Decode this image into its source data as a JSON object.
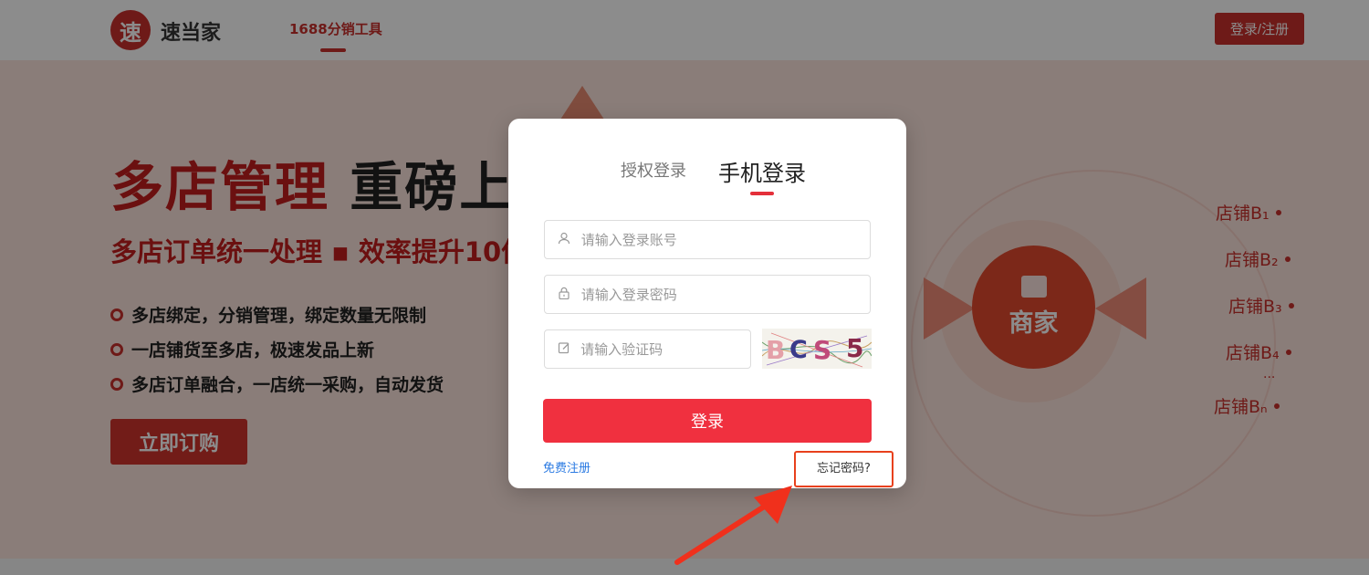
{
  "header": {
    "logo_badge": "速",
    "logo_text": "速当家",
    "nav_tab": "1688分销工具",
    "login_button": "登录/注册"
  },
  "hero": {
    "title_red": "多店管理",
    "title_dark": "重磅上线",
    "subtitle": "多店订单统一处理 ▪ 效率提升10倍",
    "features": [
      "多店绑定，分销管理，绑定数量无限制",
      "一店铺货至多店，极速发品上新",
      "多店订单融合，一店统一采购，自动发货"
    ],
    "buy_button": "立即订购",
    "merchant_label": "商家",
    "stores": [
      "店铺B₁",
      "店铺B₂",
      "店铺B₃",
      "店铺B₄",
      "店铺Bₙ"
    ],
    "stores_ellipsis": "..."
  },
  "modal": {
    "tab_auth": "授权登录",
    "tab_phone": "手机登录",
    "account_placeholder": "请输入登录账号",
    "password_placeholder": "请输入登录密码",
    "captcha_placeholder": "请输入验证码",
    "captcha_text": "BCS5",
    "submit_button": "登录",
    "register_link": "免费注册",
    "forgot_link": "忘记密码?"
  },
  "icons": {
    "user": "user-icon",
    "lock": "lock-icon",
    "captcha": "edit-icon"
  },
  "colors": {
    "brand_red": "#c9302c",
    "submit_red": "#f0303f",
    "link_blue": "#2a7ae2",
    "highlight_orange": "#e8401c"
  }
}
